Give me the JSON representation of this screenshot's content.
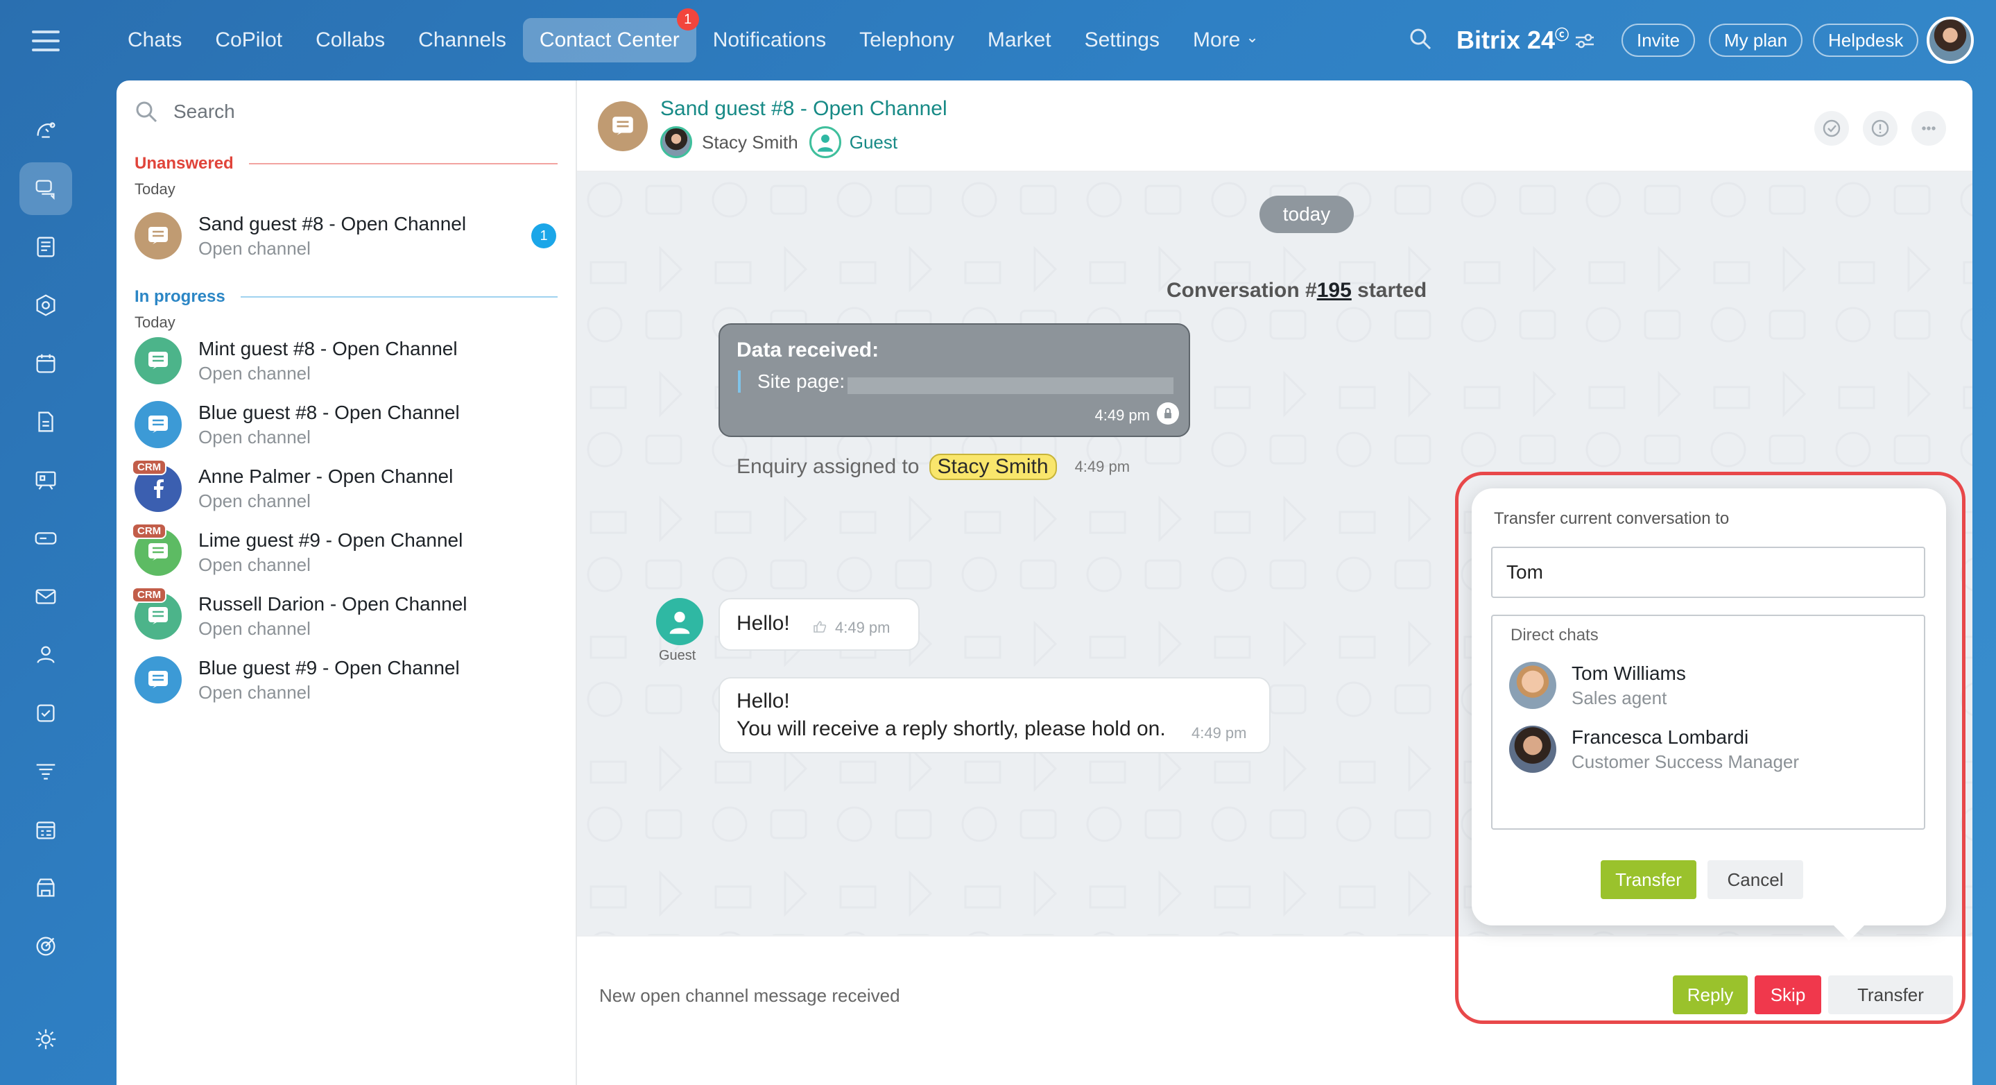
{
  "nav": {
    "items": [
      "Chats",
      "CoPilot",
      "Collabs",
      "Channels",
      "Contact Center",
      "Notifications",
      "Telephony",
      "Market",
      "Settings",
      "More"
    ],
    "active": "Contact Center",
    "badge": "1"
  },
  "brand": {
    "name": "Bitrix 24",
    "mark": "ⓒ"
  },
  "top_buttons": {
    "invite": "Invite",
    "plan": "My plan",
    "helpdesk": "Helpdesk"
  },
  "search": {
    "placeholder": "Search"
  },
  "sections": {
    "unanswered": {
      "label": "Unanswered",
      "date": "Today"
    },
    "in_progress": {
      "label": "In progress",
      "date": "Today"
    }
  },
  "chats_unanswered": [
    {
      "title": "Sand guest #8 - Open Channel",
      "sub": "Open channel",
      "badge": "1"
    }
  ],
  "chats_progress": [
    {
      "title": "Mint guest #8 - Open Channel",
      "sub": "Open channel"
    },
    {
      "title": "Blue guest #8 - Open Channel",
      "sub": "Open channel"
    },
    {
      "title": "Anne Palmer - Open Channel",
      "sub": "Open channel",
      "crm": "CRM"
    },
    {
      "title": "Lime guest #9 - Open Channel",
      "sub": "Open channel",
      "crm": "CRM"
    },
    {
      "title": "Russell Darion - Open Channel",
      "sub": "Open channel",
      "crm": "CRM"
    },
    {
      "title": "Blue guest #9 - Open Channel",
      "sub": "Open channel"
    }
  ],
  "header": {
    "title": "Sand guest #8 - Open Channel",
    "operator": "Stacy Smith",
    "guest": "Guest"
  },
  "feed": {
    "date_chip": "today",
    "conv_prefix": "Conversation #",
    "conv_number": "195",
    "conv_suffix": " started",
    "data_title": "Data received:",
    "data_label": "Site page:",
    "data_time": "4:49 pm",
    "assigned_prefix": "Enquiry assigned to",
    "assigned_who": "Stacy Smith",
    "assigned_time": "4:49 pm",
    "guest_label": "Guest",
    "msg1": "Hello!",
    "msg1_time": "4:49 pm",
    "msg2_line1": "Hello!",
    "msg2_line2": "You will receive a reply shortly, please hold on.",
    "msg2_time": "4:49 pm"
  },
  "footer": {
    "text": "New open channel message received",
    "reply": "Reply",
    "skip": "Skip",
    "transfer": "Transfer"
  },
  "transfer_popup": {
    "title": "Transfer current conversation to",
    "input_value": "Tom",
    "list_head": "Direct chats",
    "contacts": [
      {
        "name": "Tom Williams",
        "role": "Sales agent"
      },
      {
        "name": "Francesca Lombardi",
        "role": "Customer Success Manager"
      }
    ],
    "transfer": "Transfer",
    "cancel": "Cancel"
  },
  "colors": {
    "accent_green": "#9ac22c",
    "danger": "#f0384c",
    "teal": "#178a86",
    "unanswered": "#e0443a",
    "in_progress": "#2b86c5"
  }
}
